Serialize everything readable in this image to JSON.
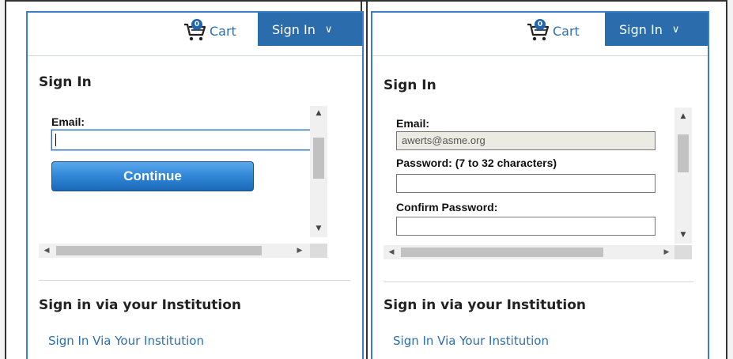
{
  "left_panel": {
    "cart_label": "Cart",
    "cart_count": "0",
    "signin_button": "Sign In",
    "chevron": "∨",
    "heading": "Sign In",
    "email_label": "Email:",
    "email_value": "",
    "continue_label": "Continue",
    "institution_heading": "Sign in via your Institution",
    "institution_link": "Sign In Via Your Institution"
  },
  "right_panel": {
    "cart_label": "Cart",
    "cart_count": "0",
    "signin_button": "Sign In",
    "chevron": "∨",
    "heading": "Sign In",
    "email_label": "Email:",
    "email_value": "awerts@asme.org",
    "password_label": "Password: (7 to 32 characters)",
    "password_value": "",
    "confirm_label": "Confirm Password:",
    "confirm_value": "",
    "institution_heading": "Sign in via your Institution",
    "institution_link": "Sign In Via Your Institution"
  },
  "icons": {
    "cart": "cart-icon",
    "chevron": "chevron-down-icon",
    "scroll_up": "▲",
    "scroll_down": "▼",
    "scroll_left": "◀",
    "scroll_right": "▶"
  },
  "colors": {
    "accent": "#2b6cad",
    "link": "#2d6fae",
    "panel_border": "#3b7ec4",
    "button_top": "#5aa8ec",
    "button_bottom": "#1b69b8"
  }
}
